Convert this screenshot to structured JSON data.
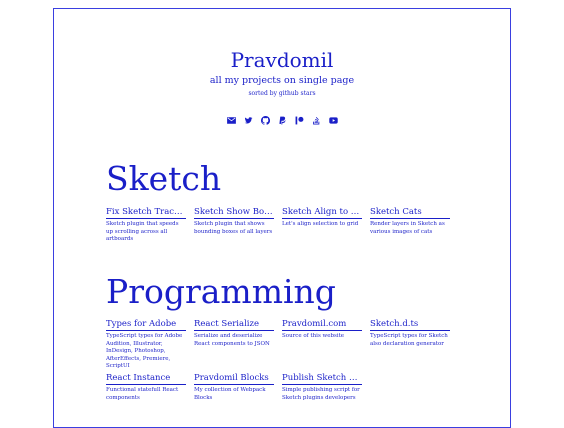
{
  "header": {
    "title": "Pravdomil",
    "subtitle": "all my projects on single page",
    "sorted_note": "sorted by github stars"
  },
  "social_icons": [
    "mail-icon",
    "twitter-icon",
    "github-icon",
    "paypal-icon",
    "patreon-icon",
    "stackoverflow-icon",
    "youtube-icon"
  ],
  "sections": [
    {
      "title": "Sketch",
      "projects": [
        {
          "name": "Fix Sketch Trackpa...",
          "desc": "Sketch plugin that speeds up scrolling across all artboards"
        },
        {
          "name": "Sketch Show Boun...",
          "desc": "Sketch plugin that shows bounding boxes of all layers"
        },
        {
          "name": "Sketch Align to Grid",
          "desc": "Let's align selection to grid"
        },
        {
          "name": "Sketch Cats",
          "desc": "Render layers in Sketch as various images of cats"
        }
      ]
    },
    {
      "title": "Programming",
      "projects": [
        {
          "name": "Types for Adobe",
          "desc": "TypeScript types for Adobe Audition, Illustrator, InDesign, Photoshop, AfterEffects, Premiere, ScriptUI"
        },
        {
          "name": "React Serialize",
          "desc": "Serialize and deserialize React components to JSON"
        },
        {
          "name": "Pravdomil.com",
          "desc": "Source of this website"
        },
        {
          "name": "Sketch.d.ts",
          "desc": "TypeScript types for Sketch also declaration generator"
        },
        {
          "name": "React Instance",
          "desc": "Functional statefull React components"
        },
        {
          "name": "Pravdomil Blocks",
          "desc": "My collection of Webpack Blocks"
        },
        {
          "name": "Publish Sketch plu...",
          "desc": "Simple publishing script for Sketch plugins developers"
        }
      ]
    }
  ],
  "colors": {
    "accent": "#1a1fc8",
    "border": "#3a3fe0",
    "background": "#ffffff"
  }
}
